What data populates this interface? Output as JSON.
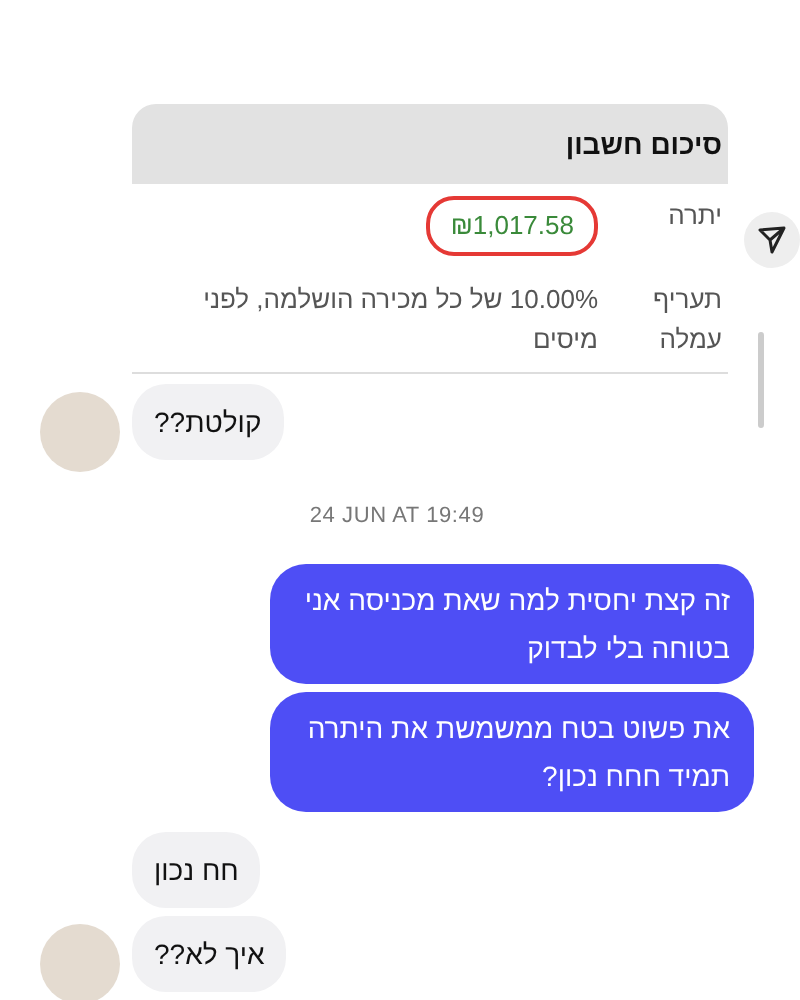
{
  "summary_card": {
    "title": "סיכום חשבון",
    "rows": [
      {
        "label": "יתרה",
        "value": "₪1,017.58",
        "circled": true
      },
      {
        "label": "תעריף עמלה",
        "value": "10.00% של כל מכירה הושלמה, לפני מיסים",
        "circled": false
      }
    ]
  },
  "messages": [
    {
      "kind": "incoming",
      "text": "קולטת??",
      "avatar": true
    },
    {
      "kind": "timestamp",
      "text": "24 JUN AT 19:49"
    },
    {
      "kind": "outgoing",
      "text": "זה קצת יחסית למה שאת מכניסה אני בטוחה בלי לבדוק"
    },
    {
      "kind": "outgoing",
      "text": "את פשוט בטח ממשמשת את היתרה תמיד חחח נכון?"
    },
    {
      "kind": "incoming",
      "text": "חח נכון",
      "avatar": false
    },
    {
      "kind": "incoming",
      "text": "איך לא??",
      "avatar": true
    }
  ]
}
